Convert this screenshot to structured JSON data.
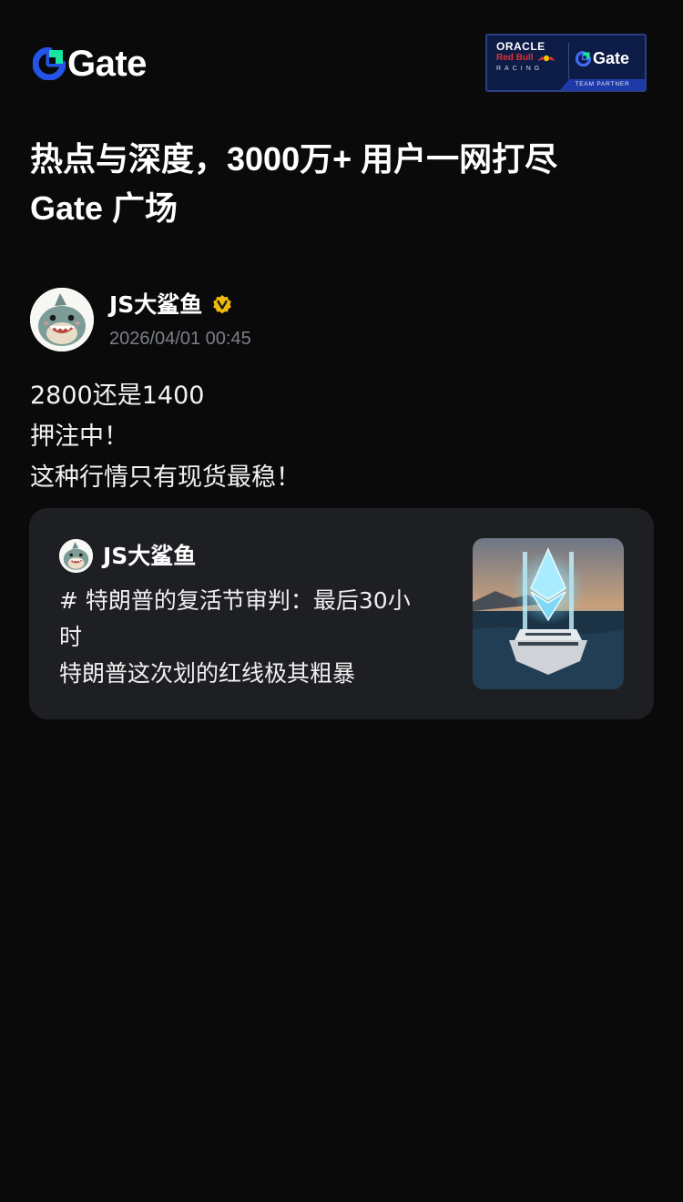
{
  "header": {
    "logo_text": "Gate",
    "partner_badge": {
      "oracle": "ORACLE",
      "red_bull": "Red Bull",
      "racing": "RACING",
      "gate": "Gate",
      "footer": "TEAM PARTNER"
    }
  },
  "headline": {
    "line1": "热点与深度，3000万+ 用户一网打尽",
    "line2": "Gate 广场"
  },
  "post": {
    "author": "JS大鲨鱼",
    "time": "2026/04/01 00:45",
    "lines": [
      "2800还是1400",
      "押注中！",
      "这种行情只有现货最稳！"
    ]
  },
  "quote": {
    "author": "JS大鲨鱼",
    "text_line1": "# 特朗普的复活节审判：最后30小",
    "text_line2": "时",
    "text_line3": "特朗普这次划的红线极其粗暴"
  },
  "colors": {
    "background": "#0a0a0b",
    "card": "#1e1f23",
    "brand_blue": "#2354e6",
    "brand_green": "#17e5a1",
    "verified_gold": "#f0b90b",
    "muted_text": "#7b7f87"
  }
}
